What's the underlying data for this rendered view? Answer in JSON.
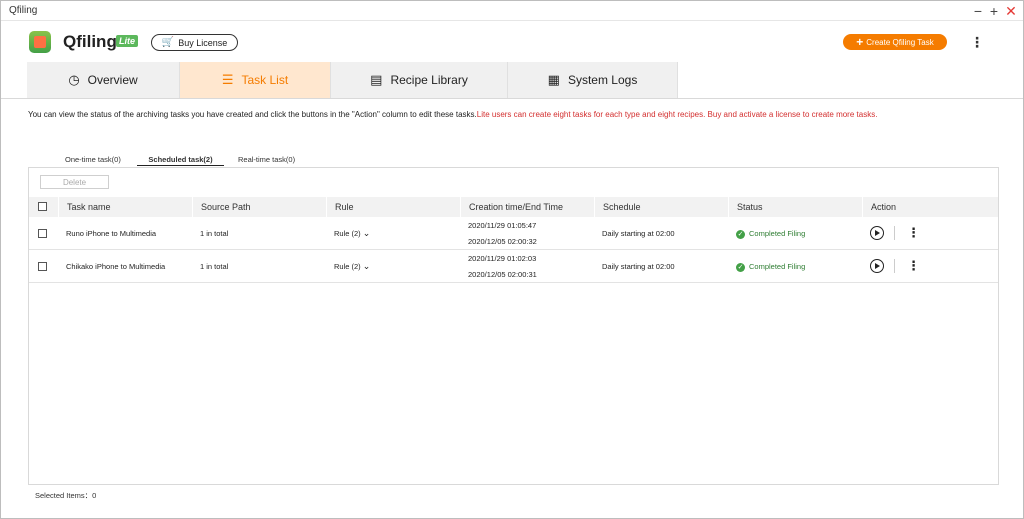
{
  "window": {
    "title": "Qfiling",
    "minimize": "−",
    "maximize": "+",
    "close": "✕"
  },
  "header": {
    "brand": "Qfiling",
    "badge": "Lite",
    "buy_license": "Buy License",
    "create_task": "Create Qfiling Task",
    "more": "⋮"
  },
  "tabs": [
    {
      "label": "Overview",
      "icon": "dashboard-icon",
      "glyph": "◷"
    },
    {
      "label": "Task List",
      "icon": "task-list-icon",
      "glyph": "☰"
    },
    {
      "label": "Recipe Library",
      "icon": "book-icon",
      "glyph": "▤"
    },
    {
      "label": "System Logs",
      "icon": "log-icon",
      "glyph": "▦"
    }
  ],
  "info": {
    "text": "You can view the status of the archiving tasks you have created and click the buttons in the \"Action\" column to edit these tasks.",
    "warning": "Lite users can create eight tasks for each type and eight recipes. Buy and activate a license to create more tasks."
  },
  "subtabs": [
    "One-time task(0)",
    "Scheduled task(2)",
    "Real-time task(0)"
  ],
  "toolbar": {
    "delete": "Delete"
  },
  "table": {
    "headers": [
      "Task name",
      "Source Path",
      "Rule",
      "Creation time/End Time",
      "Schedule",
      "Status",
      "Action"
    ],
    "rows": [
      {
        "name": "Runo iPhone to Multimedia",
        "source": "1 in total",
        "rule": "Rule (2)",
        "created": "2020/11/29 01:05:47",
        "ended": "2020/12/05 02:00:32",
        "schedule": "Daily starting at 02:00",
        "status": "Completed Filing"
      },
      {
        "name": "Chikako iPhone to Multimedia",
        "source": "1 in total",
        "rule": "Rule (2)",
        "created": "2020/11/29 01:02:03",
        "ended": "2020/12/05 02:00:31",
        "schedule": "Daily starting at 02:00",
        "status": "Completed Filing"
      }
    ]
  },
  "footer": {
    "selected": "Selected Items：0"
  },
  "colors": {
    "accent": "#f57c00",
    "success": "#43a047",
    "warning": "#d32f2f"
  }
}
